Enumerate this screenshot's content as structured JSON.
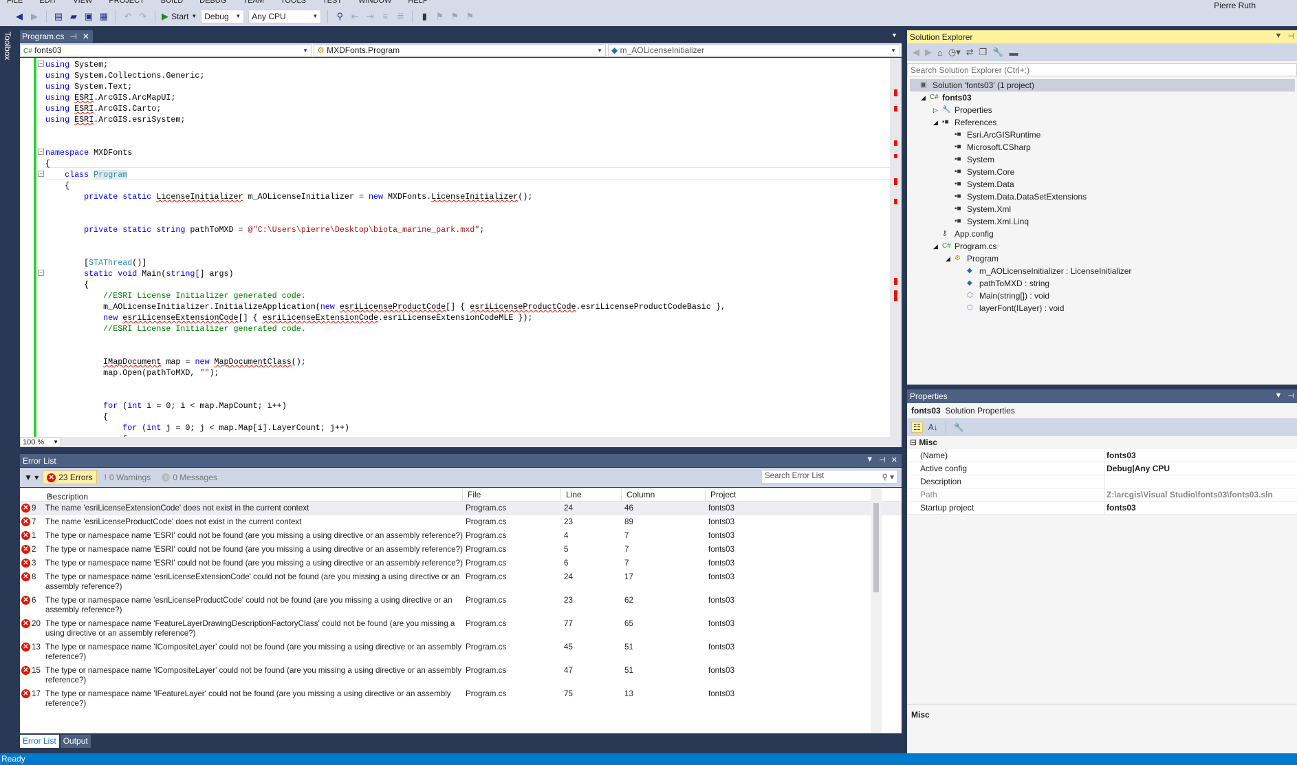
{
  "menu": [
    "FILE",
    "EDIT",
    "VIEW",
    "PROJECT",
    "BUILD",
    "DEBUG",
    "TEAM",
    "TOOLS",
    "TEST",
    "WINDOW",
    "HELP"
  ],
  "user": "Pierre Ruth",
  "toolbar": {
    "start_label": "Start",
    "config": "Debug",
    "platform": "Any CPU"
  },
  "toolbox_label": "Toolbox",
  "doc_tab": {
    "title": "Program.cs",
    "pin": "⊣",
    "close": "✕"
  },
  "navbar": {
    "project": "fonts03",
    "type": "MXDFonts.Program",
    "member": "m_AOLicenseInitializer"
  },
  "zoom": "100 %",
  "code": [
    [
      [
        "k",
        "using"
      ],
      [
        "",
        " System;"
      ]
    ],
    [
      [
        "k",
        "using"
      ],
      [
        "",
        " System.Collections.Generic;"
      ]
    ],
    [
      [
        "k",
        "using"
      ],
      [
        "",
        " System.Text;"
      ]
    ],
    [
      [
        "k",
        "using"
      ],
      [
        "",
        " "
      ],
      [
        "e",
        "ESRI"
      ],
      [
        "",
        ".ArcGIS.ArcMapUI;"
      ]
    ],
    [
      [
        "k",
        "using"
      ],
      [
        "",
        " "
      ],
      [
        "e",
        "ESRI"
      ],
      [
        "",
        ".ArcGIS.Carto;"
      ]
    ],
    [
      [
        "k",
        "using"
      ],
      [
        "",
        " "
      ],
      [
        "e",
        "ESRI"
      ],
      [
        "",
        ".ArcGIS.esriSystem;"
      ]
    ],
    [],
    [],
    [
      [
        "k",
        "namespace"
      ],
      [
        "",
        " MXDFonts"
      ]
    ],
    [
      [
        "",
        "{"
      ]
    ],
    [
      [
        "",
        "    "
      ],
      [
        "k",
        "class"
      ],
      [
        "",
        " "
      ],
      [
        "t hl",
        "Program"
      ]
    ],
    [
      [
        "",
        "    {"
      ]
    ],
    [
      [
        "",
        "        "
      ],
      [
        "k",
        "private static"
      ],
      [
        "",
        " "
      ],
      [
        "e",
        "LicenseInitializer"
      ],
      [
        "",
        " m_AOLicenseInitializer = "
      ],
      [
        "k",
        "new"
      ],
      [
        "",
        " MXDFonts."
      ],
      [
        "e",
        "LicenseInitializer"
      ],
      [
        "",
        "();"
      ]
    ],
    [],
    [],
    [
      [
        "",
        "        "
      ],
      [
        "k",
        "private static string"
      ],
      [
        "",
        " pathToMXD = "
      ],
      [
        "s",
        "@\"C:\\Users\\pierre\\Desktop\\biota_marine_park.mxd\""
      ],
      [
        "",
        ";"
      ]
    ],
    [],
    [],
    [
      [
        "",
        "        ["
      ],
      [
        "t",
        "STAThread"
      ],
      [
        "",
        "()]"
      ]
    ],
    [
      [
        "",
        "        "
      ],
      [
        "k",
        "static void"
      ],
      [
        "",
        " Main("
      ],
      [
        "k",
        "string"
      ],
      [
        "",
        "[] args)"
      ]
    ],
    [
      [
        "",
        "        {"
      ]
    ],
    [
      [
        "c",
        "            //ESRI License Initializer generated code."
      ]
    ],
    [
      [
        "",
        "            m_AOLicenseInitializer.InitializeApplication("
      ],
      [
        "k",
        "new"
      ],
      [
        "",
        " "
      ],
      [
        "e",
        "esriLicenseProductCode"
      ],
      [
        "",
        "[] { "
      ],
      [
        "e",
        "esriLicenseProductCode"
      ],
      [
        "",
        ".esriLicenseProductCodeBasic },"
      ]
    ],
    [
      [
        "",
        "            "
      ],
      [
        "k",
        "new"
      ],
      [
        "",
        " "
      ],
      [
        "e",
        "esriLicenseExtensionCode"
      ],
      [
        "",
        "[] { "
      ],
      [
        "e",
        "esriLicenseExtensionCode"
      ],
      [
        "",
        ".esriLicenseExtensionCodeMLE });"
      ]
    ],
    [
      [
        "c",
        "            //ESRI License Initializer generated code."
      ]
    ],
    [],
    [],
    [
      [
        "",
        "            "
      ],
      [
        "e",
        "IMapDocument"
      ],
      [
        "",
        " map = "
      ],
      [
        "k",
        "new"
      ],
      [
        "",
        " "
      ],
      [
        "e",
        "MapDocumentClass"
      ],
      [
        "",
        "();"
      ]
    ],
    [
      [
        "",
        "            map.Open(pathToMXD, "
      ],
      [
        "s",
        "\"\""
      ],
      [
        "",
        ");"
      ]
    ],
    [],
    [],
    [
      [
        "",
        "            "
      ],
      [
        "k",
        "for"
      ],
      [
        "",
        " ("
      ],
      [
        "k",
        "int"
      ],
      [
        "",
        " i = 0; i < map.MapCount; i++)"
      ]
    ],
    [
      [
        "",
        "            {"
      ]
    ],
    [
      [
        "",
        "                "
      ],
      [
        "k",
        "for"
      ],
      [
        "",
        " ("
      ],
      [
        "k",
        "int"
      ],
      [
        "",
        " j = 0; j < map.Map[i].LayerCount; j++)"
      ]
    ],
    [
      [
        "",
        "                {"
      ]
    ]
  ],
  "error_list": {
    "title": "Error List",
    "errors_label": "23 Errors",
    "warnings_label": "0 Warnings",
    "messages_label": "0 Messages",
    "search_placeholder": "Search Error List",
    "columns": {
      "description": "Description",
      "file": "File",
      "line": "Line",
      "column": "Column",
      "project": "Project"
    },
    "rows": [
      {
        "num": "9",
        "desc": "The name 'esriLicenseExtensionCode' does not exist in the current context",
        "file": "Program.cs",
        "line": "24",
        "col": "46",
        "project": "fonts03"
      },
      {
        "num": "7",
        "desc": "The name 'esriLicenseProductCode' does not exist in the current context",
        "file": "Program.cs",
        "line": "23",
        "col": "89",
        "project": "fonts03"
      },
      {
        "num": "1",
        "desc": "The type or namespace name 'ESRI' could not be found (are you missing a using directive or an assembly reference?)",
        "file": "Program.cs",
        "line": "4",
        "col": "7",
        "project": "fonts03"
      },
      {
        "num": "2",
        "desc": "The type or namespace name 'ESRI' could not be found (are you missing a using directive or an assembly reference?)",
        "file": "Program.cs",
        "line": "5",
        "col": "7",
        "project": "fonts03"
      },
      {
        "num": "3",
        "desc": "The type or namespace name 'ESRI' could not be found (are you missing a using directive or an assembly reference?)",
        "file": "Program.cs",
        "line": "6",
        "col": "7",
        "project": "fonts03"
      },
      {
        "num": "8",
        "desc": "The type or namespace name 'esriLicenseExtensionCode' could not be found (are you missing a using directive or an assembly reference?)",
        "file": "Program.cs",
        "line": "24",
        "col": "17",
        "project": "fonts03"
      },
      {
        "num": "6",
        "desc": "The type or namespace name 'esriLicenseProductCode' could not be found (are you missing a using directive or an assembly reference?)",
        "file": "Program.cs",
        "line": "23",
        "col": "62",
        "project": "fonts03"
      },
      {
        "num": "20",
        "desc": "The type or namespace name 'FeatureLayerDrawingDescriptionFactoryClass' could not be found (are you missing a using directive or an assembly reference?)",
        "file": "Program.cs",
        "line": "77",
        "col": "65",
        "project": "fonts03"
      },
      {
        "num": "13",
        "desc": "The type or namespace name 'ICompositeLayer' could not be found (are you missing a using directive or an assembly reference?)",
        "file": "Program.cs",
        "line": "45",
        "col": "51",
        "project": "fonts03"
      },
      {
        "num": "15",
        "desc": "The type or namespace name 'ICompositeLayer' could not be found (are you missing a using directive or an assembly reference?)",
        "file": "Program.cs",
        "line": "47",
        "col": "51",
        "project": "fonts03"
      },
      {
        "num": "17",
        "desc": "The type or namespace name 'IFeatureLayer' could not be found (are you missing a using directive or an assembly reference?)",
        "file": "Program.cs",
        "line": "75",
        "col": "13",
        "project": "fonts03"
      }
    ]
  },
  "bottom_tabs": [
    "Error List",
    "Output"
  ],
  "status": "Ready",
  "solution_explorer": {
    "title": "Solution Explorer",
    "search_placeholder": "Search Solution Explorer (Ctrl+;)",
    "tree": [
      {
        "label": "Solution 'fonts03' (1 project)",
        "level": 0,
        "icon": "solution-icon",
        "selected": true
      },
      {
        "label": "fonts03",
        "level": 1,
        "icon": "csharp-project-icon",
        "arrow": "expanded",
        "bold": true
      },
      {
        "label": "Properties",
        "level": 2,
        "icon": "wrench-icon",
        "arrow": "collapsed"
      },
      {
        "label": "References",
        "level": 2,
        "icon": "references-icon",
        "arrow": "expanded"
      },
      {
        "label": "Esri.ArcGISRuntime",
        "level": 3,
        "icon": "reference-icon"
      },
      {
        "label": "Microsoft.CSharp",
        "level": 3,
        "icon": "reference-icon"
      },
      {
        "label": "System",
        "level": 3,
        "icon": "reference-icon"
      },
      {
        "label": "System.Core",
        "level": 3,
        "icon": "reference-icon"
      },
      {
        "label": "System.Data",
        "level": 3,
        "icon": "reference-icon"
      },
      {
        "label": "System.Data.DataSetExtensions",
        "level": 3,
        "icon": "reference-icon"
      },
      {
        "label": "System.Xml",
        "level": 3,
        "icon": "reference-icon"
      },
      {
        "label": "System.Xml.Linq",
        "level": 3,
        "icon": "reference-icon"
      },
      {
        "label": "App.config",
        "level": 2,
        "icon": "config-file-icon"
      },
      {
        "label": "Program.cs",
        "level": 2,
        "icon": "csharp-file-icon",
        "arrow": "expanded"
      },
      {
        "label": "Program",
        "level": 3,
        "icon": "class-icon",
        "arrow": "expanded"
      },
      {
        "label": "m_AOLicenseInitializer : LicenseInitializer",
        "level": 4,
        "icon": "field-icon"
      },
      {
        "label": "pathToMXD : string",
        "level": 4,
        "icon": "field-icon"
      },
      {
        "label": "Main(string[]) : void",
        "level": 4,
        "icon": "method-icon"
      },
      {
        "label": "layerFont(ILayer) : void",
        "level": 4,
        "icon": "method-icon"
      }
    ]
  },
  "properties": {
    "title": "Properties",
    "object_name": "fonts03",
    "object_type": "Solution Properties",
    "category": "Misc",
    "rows": [
      {
        "name": "(Name)",
        "value": "fonts03"
      },
      {
        "name": "Active config",
        "value": "Debug|Any CPU"
      },
      {
        "name": "Description",
        "value": ""
      },
      {
        "name": "Path",
        "value": "Z:\\arcgis\\Visual Studio\\fonts03\\fonts03.sln",
        "readonly": true
      },
      {
        "name": "Startup project",
        "value": "fonts03"
      }
    ],
    "description_title": "Misc"
  },
  "colors": {
    "chrome": "#293955",
    "panel_header": "#4d6082",
    "active_header": "#fff29d",
    "status_bar": "#007acc",
    "error": "#e51400"
  }
}
